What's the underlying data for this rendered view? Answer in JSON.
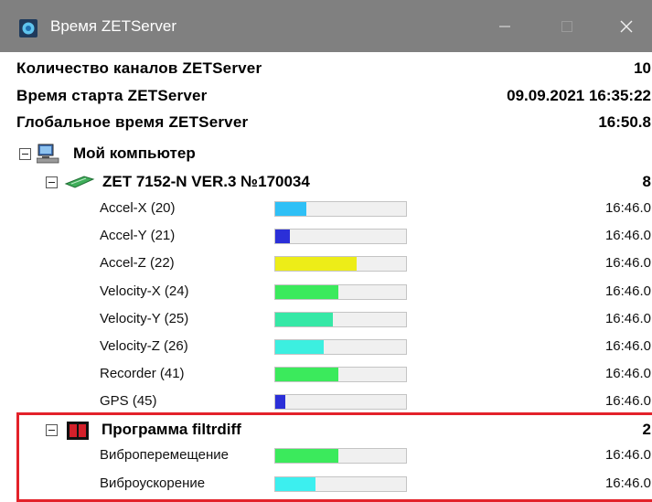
{
  "window": {
    "title": "Время ZETServer",
    "minimize_icon": "minimize-icon",
    "maximize_icon": "maximize-icon",
    "close_icon": "close-icon",
    "app_icon": "zet-app-icon"
  },
  "info": [
    {
      "label": "Количество каналов ZETServer",
      "value": "10"
    },
    {
      "label": "Время старта ZETServer",
      "value": "09.09.2021 16:35:22"
    },
    {
      "label": "Глобальное время ZETServer",
      "value": "16:50.8"
    }
  ],
  "tree": {
    "computer": {
      "label": "Мой компьютер",
      "icon": "computer-icon"
    },
    "device": {
      "label": "ZET 7152-N VER.3 №170034",
      "count": "8",
      "icon": "device-board-icon"
    },
    "device_channels": [
      {
        "name": "Accel-X (20)",
        "level": 0.24,
        "color": "#2fc0f6",
        "time": "16:46.0"
      },
      {
        "name": "Accel-Y (21)",
        "level": 0.11,
        "color": "#2b2fd8",
        "time": "16:46.0"
      },
      {
        "name": "Accel-Z (22)",
        "level": 0.62,
        "color": "#eded18",
        "time": "16:46.0"
      },
      {
        "name": "Velocity-X (24)",
        "level": 0.48,
        "color": "#3bea5c",
        "time": "16:46.0"
      },
      {
        "name": "Velocity-Y (25)",
        "level": 0.44,
        "color": "#36e8a6",
        "time": "16:46.0"
      },
      {
        "name": "Velocity-Z (26)",
        "level": 0.37,
        "color": "#3cefe0",
        "time": "16:46.0"
      },
      {
        "name": "Recorder (41)",
        "level": 0.48,
        "color": "#3bea5c",
        "time": "16:46.0"
      },
      {
        "name": "GPS (45)",
        "level": 0.08,
        "color": "#2b2fd8",
        "time": "16:46.0"
      }
    ],
    "program": {
      "label": "Программа filtrdiff",
      "count": "2",
      "icon": "filtrdiff-program-icon"
    },
    "program_channels": [
      {
        "name": "Виброперемещение",
        "level": 0.48,
        "color": "#3bea5c",
        "time": "16:46.0"
      },
      {
        "name": "Виброускорение",
        "level": 0.31,
        "color": "#3cefef",
        "time": "16:46.0"
      }
    ]
  },
  "colors": {
    "titlebar": "#808080",
    "highlight_border": "#e3222a"
  }
}
